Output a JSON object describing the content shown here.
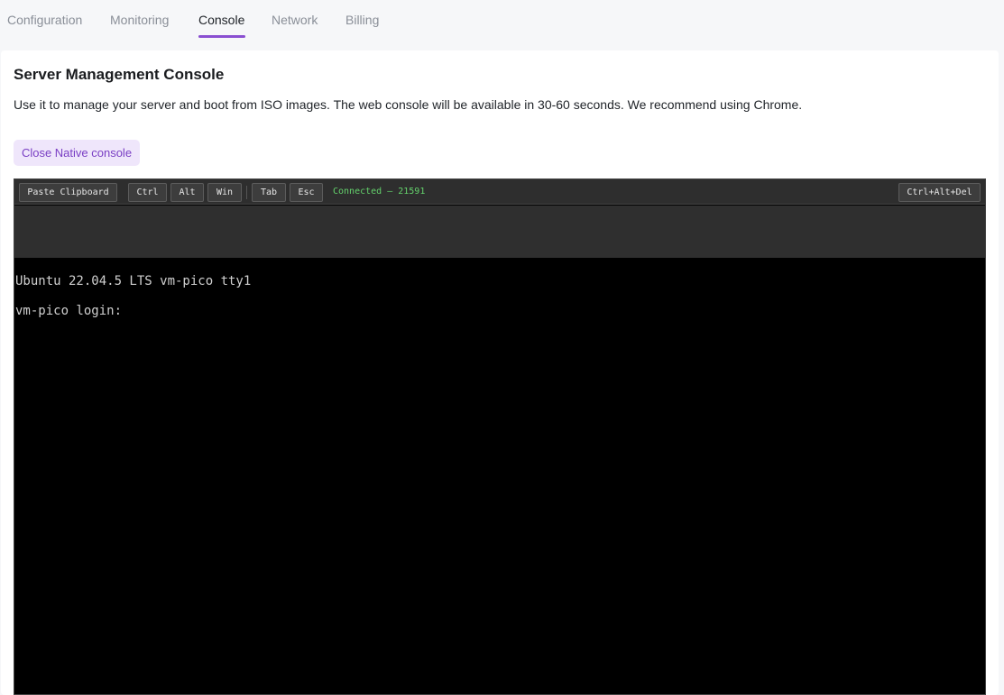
{
  "tabs": [
    {
      "label": "Configuration",
      "active": false
    },
    {
      "label": "Monitoring",
      "active": false
    },
    {
      "label": "Console",
      "active": true
    },
    {
      "label": "Network",
      "active": false
    },
    {
      "label": "Billing",
      "active": false
    }
  ],
  "card": {
    "title": "Server Management Console",
    "description": "Use it to manage your server and boot from ISO images. The web console will be available in 30-60 seconds. We recommend using Chrome.",
    "close_button": "Close Native console"
  },
  "console": {
    "toolbar": {
      "paste": "Paste Clipboard",
      "ctrl": "Ctrl",
      "alt": "Alt",
      "win": "Win",
      "tab": "Tab",
      "esc": "Esc",
      "status": "Connected — 21591",
      "ctrl_alt_del": "Ctrl+Alt+Del"
    },
    "screen": {
      "line1": "Ubuntu 22.04.5 LTS vm-pico tty1",
      "line2": "vm-pico login:"
    }
  },
  "colors": {
    "accent": "#8a4fd1",
    "status_connected": "#64d26c"
  }
}
